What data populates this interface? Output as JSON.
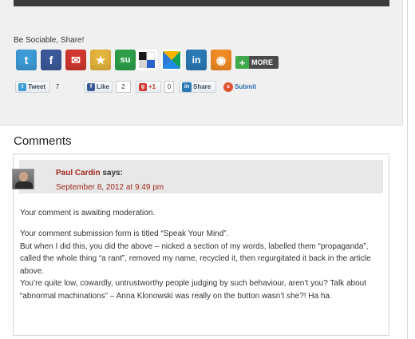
{
  "share": {
    "title": "Be Sociable, Share!",
    "icons": [
      {
        "name": "twitter-icon",
        "glyph": "t",
        "color": "#3d9bd6"
      },
      {
        "name": "facebook-icon",
        "glyph": "f",
        "color": "#3b5998"
      },
      {
        "name": "email-icon",
        "glyph": "✉",
        "color": "#d0372f"
      },
      {
        "name": "favorite-star-icon",
        "glyph": "★",
        "color": "#e3b33b"
      },
      {
        "name": "stumbleupon-icon",
        "glyph": "su",
        "color": "#2d9f4a"
      },
      {
        "name": "delicious-icon",
        "glyph": "",
        "color": "#2a61c9"
      },
      {
        "name": "google-bookmarks-icon",
        "glyph": "",
        "color": "#2b7ad8"
      },
      {
        "name": "linkedin-icon",
        "glyph": "in",
        "color": "#2a78b4"
      },
      {
        "name": "rss-orange-icon",
        "glyph": "◉",
        "color": "#f08a24"
      }
    ],
    "more_label": "MORE",
    "tweet_label": "Tweet",
    "tweet_count": "7",
    "like_label": "Like",
    "like_count": "2",
    "plusone_label": "+1",
    "plusone_count": "0",
    "linkedin_share_label": "Share",
    "submit_label": "Submit"
  },
  "comments": {
    "heading": "Comments",
    "items": [
      {
        "author": "Paul Cardin",
        "says": "says:",
        "date": "September 8, 2012 at 9:49 pm",
        "moderation": "Your comment is awaiting moderation.",
        "paragraphs": [
          "Your comment submission form is titled “Speak Your Mind”.",
          "But when I did this, you did the above – nicked a section of my words, labelled them “propaganda”, called the whole thing “a rant”, removed my name, recycled it, then regurgitated it back in the article above.",
          "You’re quite low, cowardly, untrustworthy people judging by such behaviour, aren’t you? Talk about “abnormal machinations” – Anna Klonowski was really on the button wasn’t she?! Ha ha."
        ]
      }
    ]
  }
}
